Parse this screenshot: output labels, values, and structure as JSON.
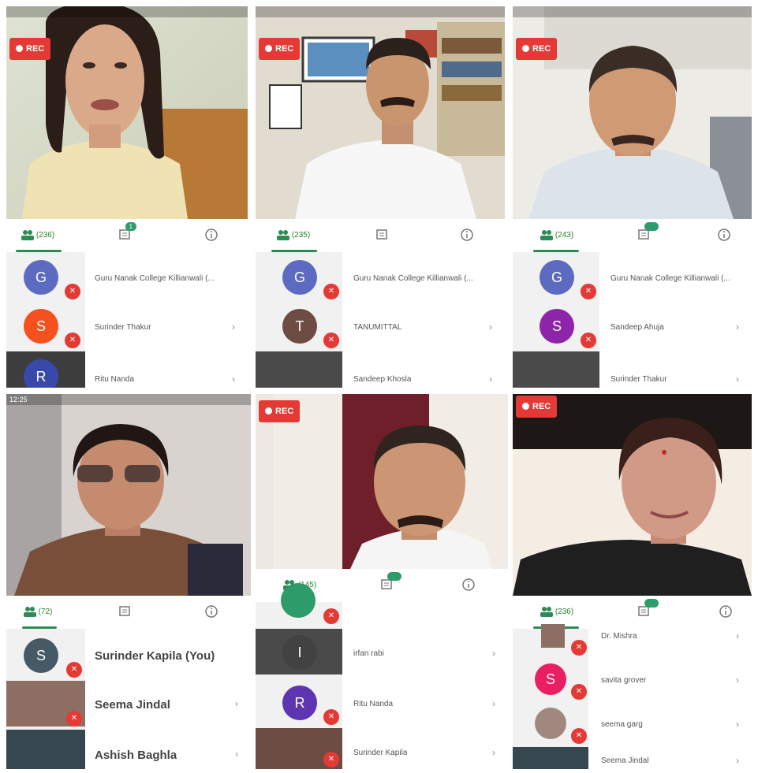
{
  "colors": {
    "rec_red": "#e53935",
    "tab_green": "#2e8b57",
    "badge_green": "#2e9c6a"
  },
  "rec_label": "REC",
  "tabs_icons": [
    "people-icon",
    "chat-icon",
    "info-icon"
  ],
  "panels": {
    "p1": {
      "participants_count": "(236)",
      "rows": [
        {
          "initial": "G",
          "avatar_color": "#5c6bc0",
          "name": "Guru Nanak College Killianwali (..."
        },
        {
          "initial": "S",
          "avatar_color": "#f4511e",
          "name": "Surinder Thakur"
        },
        {
          "initial": "R",
          "avatar_color": "#3949ab",
          "name": "Ritu Nanda"
        }
      ],
      "chat_badge": "1"
    },
    "p2": {
      "participants_count": "(235)",
      "rows": [
        {
          "initial": "G",
          "avatar_color": "#5c6bc0",
          "name": "Guru Nanak College Killianwali (..."
        },
        {
          "initial": "T",
          "avatar_color": "#6d4c41",
          "name": "TANUMITTAL"
        },
        {
          "initial": "",
          "avatar_color": "#555555",
          "name": "Sandeep Khosla"
        }
      ]
    },
    "p3": {
      "participants_count": "(243)",
      "rows": [
        {
          "initial": "G",
          "avatar_color": "#5c6bc0",
          "name": "Guru Nanak College Killianwali (..."
        },
        {
          "initial": "S",
          "avatar_color": "#8e24aa",
          "name": "Sandeep Ahuja"
        },
        {
          "initial": "",
          "avatar_color": "#6d4c41",
          "name": "Surinder Thakur"
        }
      ]
    },
    "p4": {
      "status_time": "12:25",
      "participants_count": "(72)",
      "rows": [
        {
          "initial": "S",
          "avatar_color": "#455a64",
          "name": "Surinder Kapila (You)"
        },
        {
          "initial": "",
          "avatar_color": "#8d6e63",
          "name": "Seema Jindal"
        },
        {
          "initial": "",
          "avatar_color": "#37474f",
          "name": "Ashish Baghla"
        }
      ]
    },
    "p5": {
      "participants_count": "(145)",
      "rows": [
        {
          "initial": "",
          "avatar_color": "#2e9c6a",
          "name": ""
        },
        {
          "initial": "I",
          "avatar_color": "#424242",
          "name": "irfan rabi"
        },
        {
          "initial": "R",
          "avatar_color": "#5e35b1",
          "name": "Ritu Nanda"
        },
        {
          "initial": "",
          "avatar_color": "#6d4c41",
          "name": "Surinder Kapila"
        }
      ]
    },
    "p6": {
      "participants_count": "(236)",
      "rows": [
        {
          "initial": "",
          "avatar_color": "#8d6e63",
          "name": "Dr. Mishra"
        },
        {
          "initial": "S",
          "avatar_color": "#e91e63",
          "name": "savita grover"
        },
        {
          "initial": "",
          "avatar_color": "#a1887f",
          "name": "seema garg"
        },
        {
          "initial": "",
          "avatar_color": "#37474f",
          "name": "Seema Jindal"
        }
      ]
    }
  }
}
